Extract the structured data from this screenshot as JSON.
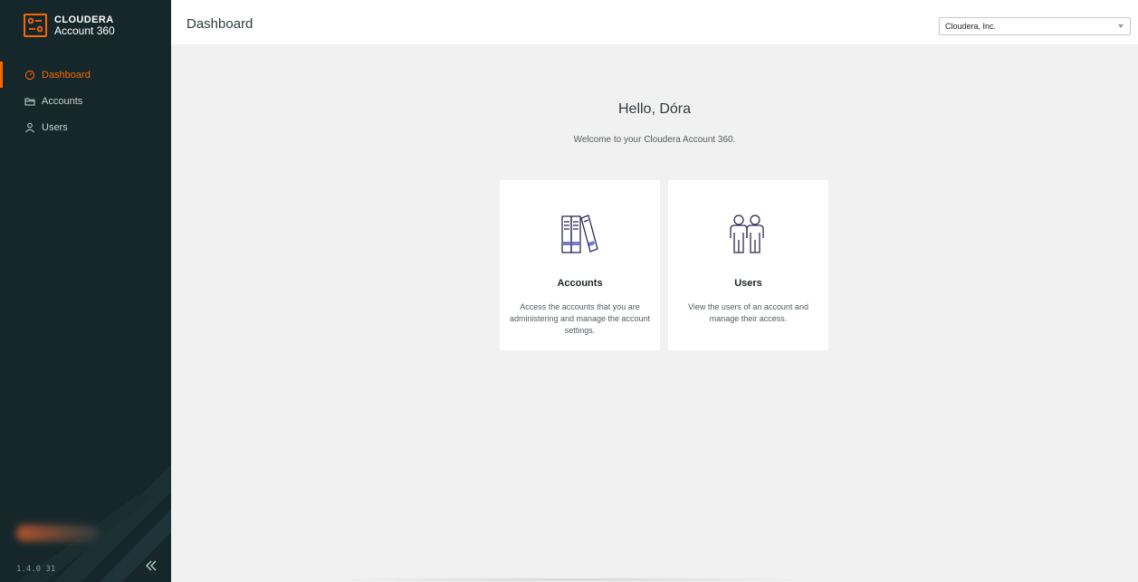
{
  "brand": {
    "name": "CLOUDERA",
    "product": "Account 360"
  },
  "sidebar": {
    "items": [
      {
        "label": "Dashboard",
        "icon": "dashboard-gauge-icon",
        "active": true
      },
      {
        "label": "Accounts",
        "icon": "folder-icon",
        "active": false
      },
      {
        "label": "Users",
        "icon": "user-icon",
        "active": false
      }
    ],
    "version": "1.4.0 31",
    "collapse_icon": "double-chevron-left-icon"
  },
  "header": {
    "title": "Dashboard",
    "account_select": {
      "value": "Cloudera, Inc."
    }
  },
  "main": {
    "greeting": "Hello, Dóra",
    "welcome": "Welcome to your Cloudera Account 360.",
    "cards": [
      {
        "title": "Accounts",
        "description": "Access the accounts that you are administering and manage the account settings.",
        "icon": "books-icon"
      },
      {
        "title": "Users",
        "description": "View the users of an account and manage their access.",
        "icon": "two-users-icon"
      }
    ]
  },
  "colors": {
    "accent": "#f96702",
    "sidebar_bg": "#16272b",
    "content_bg": "#f1f1f1",
    "icon_stroke": "#2c2a5a"
  }
}
